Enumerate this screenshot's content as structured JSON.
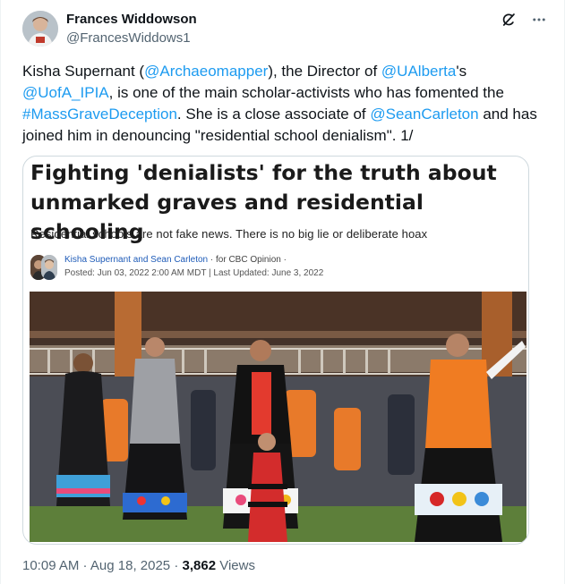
{
  "author": {
    "name": "Frances Widdowson",
    "handle": "@FrancesWiddows1"
  },
  "header_icons": [
    "grok-icon",
    "more-icon"
  ],
  "tweet": {
    "t1": "Kisha Supernant (",
    "mention1": "@Archaeomapper",
    "t2": "), the Director of ",
    "mention2": "@UAlberta",
    "t3": "'s ",
    "mention3": "@UofA_IPIA",
    "t4": ", is one of the main scholar-activists who has fomented the ",
    "hashtag1": "#MassGraveDeception",
    "t5": ".  She is a close associate of ",
    "mention4": "@SeanCarleton",
    "t6": " and has joined him in denouncing \"residential school denialism\". 1/"
  },
  "card": {
    "headline": "Fighting 'denialists' for the truth about unmarked graves and residential schooling",
    "subheadline": "Residential schools are not fake news. There is no big lie or deliberate hoax",
    "authors": "Kisha Supernant and Sean Carleton",
    "byline_suffix": " · for CBC Opinion ·",
    "dates": "Posted: Jun 03, 2022 2:00 AM MDT | Last Updated: June 3, 2022"
  },
  "meta": {
    "time": "10:09 AM",
    "sep1": " · ",
    "date": "Aug 18, 2025",
    "sep2": " · ",
    "views_count": "3,862",
    "views_label": " Views"
  },
  "colors": {
    "link": "#1d9bf0",
    "secondary_text": "#536471",
    "border": "#cfd9de"
  }
}
